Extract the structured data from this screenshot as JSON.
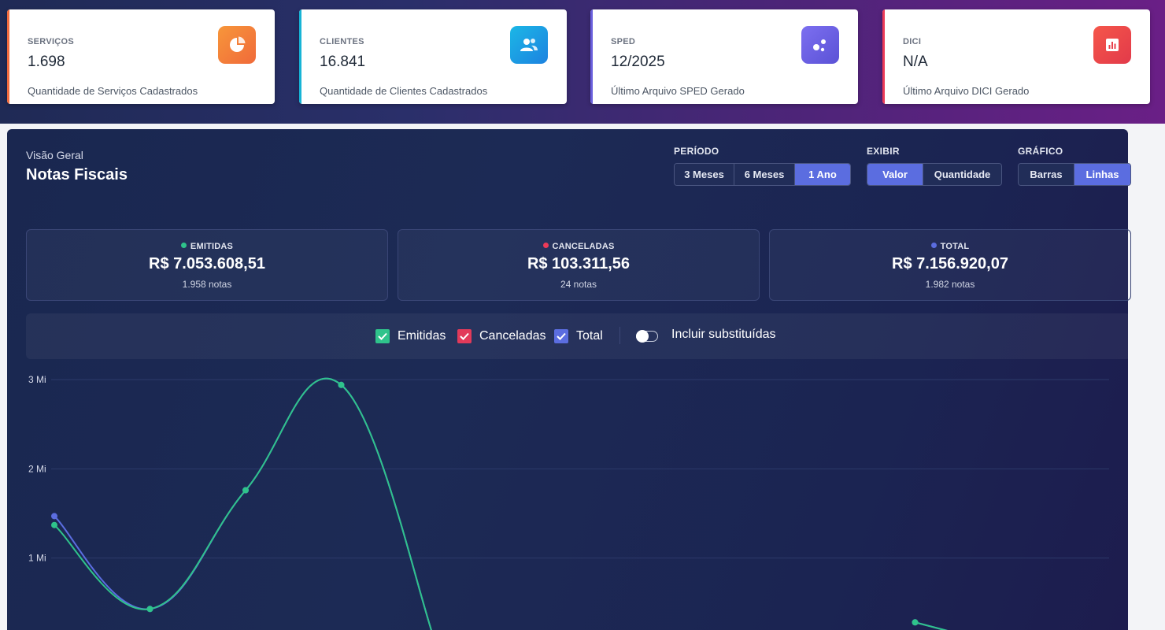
{
  "stat_cards": [
    {
      "label": "SERVIÇOS",
      "value": "1.698",
      "description": "Quantidade de Serviços Cadastrados",
      "icon": "pie-chart-icon",
      "accent": "#f26a3d"
    },
    {
      "label": "CLIENTES",
      "value": "16.841",
      "description": "Quantidade de Clientes Cadastrados",
      "icon": "users-icon",
      "accent": "#17b4d6"
    },
    {
      "label": "SPED",
      "value": "12/2025",
      "description": "Último Arquivo SPED Gerado",
      "icon": "molecule-icon",
      "accent": "#6a5fdc"
    },
    {
      "label": "DICI",
      "value": "N/A",
      "description": "Último Arquivo DICI Gerado",
      "icon": "bar-chart-icon",
      "accent": "#ec3a58"
    }
  ],
  "panel": {
    "overline": "Visão Geral",
    "title": "Notas Fiscais"
  },
  "controls": {
    "periodo": {
      "label": "PERÍODO",
      "options": [
        "3 Meses",
        "6 Meses",
        "1 Ano"
      ],
      "active": "1 Ano"
    },
    "exibir": {
      "label": "EXIBIR",
      "options": [
        "Valor",
        "Quantidade"
      ],
      "active": "Valor"
    },
    "grafico": {
      "label": "GRÁFICO",
      "options": [
        "Barras",
        "Linhas"
      ],
      "active": "Linhas"
    }
  },
  "summary": [
    {
      "label": "EMITIDAS",
      "value": "R$ 7.053.608,51",
      "count": "1.958 notas",
      "color": "#2fc38b"
    },
    {
      "label": "CANCELADAS",
      "value": "R$ 103.311,56",
      "count": "24 notas",
      "color": "#ec3a58"
    },
    {
      "label": "TOTAL",
      "value": "R$ 7.156.920,07",
      "count": "1.982 notas",
      "color": "#5b6de0"
    }
  ],
  "legend": {
    "items": [
      {
        "label": "Emitidas",
        "checked": true,
        "color": "#2fc38b"
      },
      {
        "label": "Canceladas",
        "checked": true,
        "color": "#e23a5a"
      },
      {
        "label": "Total",
        "checked": true,
        "color": "#5b6de0"
      }
    ],
    "toggle_label": "Incluir substituídas",
    "toggle_on": false
  },
  "chart_data": {
    "type": "line",
    "y_ticks": [
      "3 Mi",
      "2 Mi",
      "1 Mi"
    ],
    "ylim": [
      0,
      3000000
    ],
    "grid": true,
    "series": [
      {
        "name": "Emitidas",
        "color": "#2fc38b",
        "values": [
          1370000,
          430000,
          1760000,
          2940000,
          0,
          null,
          null,
          null,
          null,
          280000,
          0
        ]
      },
      {
        "name": "Total",
        "color": "#5b6de0",
        "values": [
          1470000,
          430000,
          1760000,
          2940000,
          0,
          null,
          null,
          null,
          null,
          280000,
          0
        ]
      }
    ]
  }
}
